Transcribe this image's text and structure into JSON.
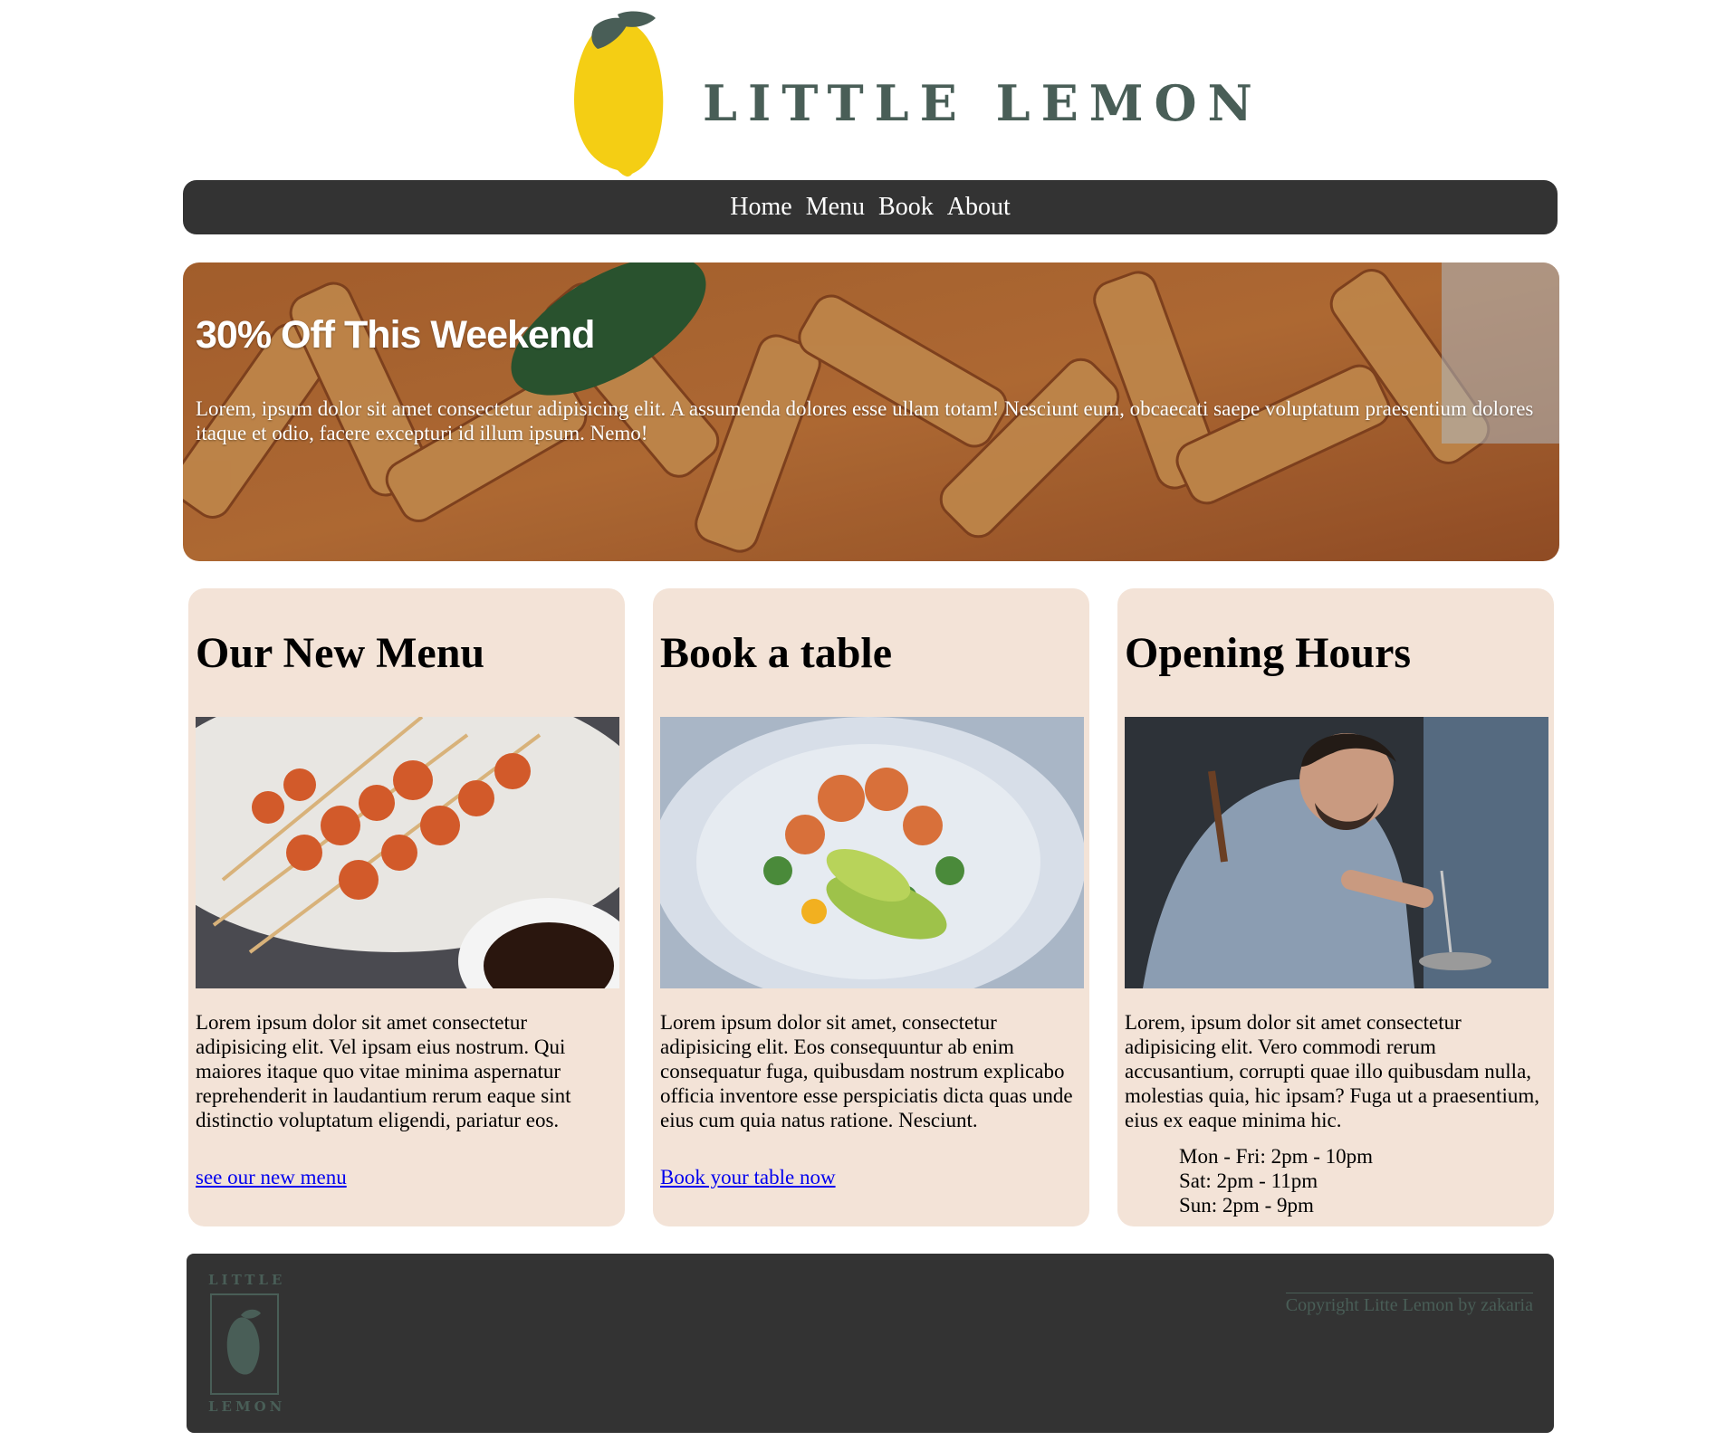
{
  "brand": {
    "name": "LITTLE LEMON",
    "footer_logo_top": "LITTLE",
    "footer_logo_bottom": "LEMON",
    "colors": {
      "primary_green": "#495e57",
      "lemon_yellow": "#f4ce14",
      "dark_bar": "#333333",
      "card_bg": "#f3e3d7",
      "link": "#0000ee"
    }
  },
  "nav": {
    "items": [
      {
        "label": "Home"
      },
      {
        "label": "Menu"
      },
      {
        "label": "Book"
      },
      {
        "label": "About"
      }
    ]
  },
  "hero": {
    "title": "30% Off This Weekend",
    "text": "Lorem, ipsum dolor sit amet consectetur adipisicing elit. A assumenda dolores esse ullam totam! Nesciunt eum, obcaecati saepe voluptatum praesentium dolores itaque et odio, facere excepturi id illum ipsum. Nemo!",
    "image": "penne-pasta-photo"
  },
  "cards": [
    {
      "title": "Our New Menu",
      "image": "grilled-seafood-skewers-photo",
      "text": "Lorem ipsum dolor sit amet consectetur adipisicing elit. Vel ipsam eius nostrum. Qui maiores itaque quo vitae minima aspernatur reprehenderit in laudantium rerum eaque sint distinctio voluptatum eligendi, pariatur eos.",
      "link": "see our new menu"
    },
    {
      "title": "Book a table",
      "image": "shrimp-avocado-salad-photo",
      "text": "Lorem ipsum dolor sit amet, consectetur adipisicing elit. Eos consequuntur ab enim consequatur fuga, quibusdam nostrum explicabo officia inventore esse perspiciatis dicta quas unde eius cum quia natus ratione. Nesciunt.",
      "link": "Book your table now"
    },
    {
      "title": "Opening Hours",
      "image": "chef-plating-photo",
      "text": "Lorem, ipsum dolor sit amet consectetur adipisicing elit. Vero commodi rerum accusantium, corrupti quae illo quibusdam nulla, molestias quia, hic ipsam? Fuga ut a praesentium, eius ex eaque minima hic.",
      "hours": [
        "Mon - Fri: 2pm - 10pm",
        "Sat: 2pm - 11pm",
        "Sun: 2pm - 9pm"
      ]
    }
  ],
  "footer": {
    "copyright": "Copyright Litte Lemon by zakaria"
  }
}
